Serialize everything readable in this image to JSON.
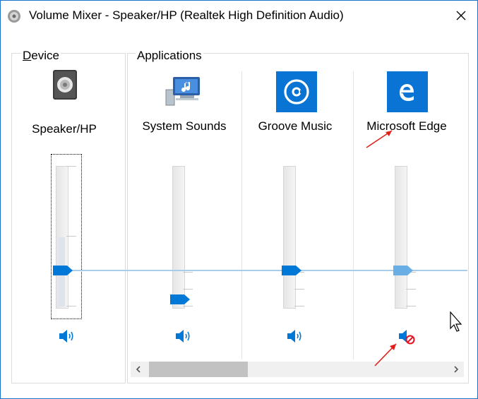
{
  "window": {
    "title": "Volume Mixer - Speaker/HP (Realtek High Definition Audio)",
    "accent": "#0078d7"
  },
  "device": {
    "group_label_prefix": "",
    "group_label_mnemonic": "D",
    "group_label_rest": "evice",
    "name": "Speaker/HP",
    "icon": "speaker-box-icon",
    "volume_percent": 50,
    "muted": false
  },
  "applications": {
    "group_label": "Applications",
    "items": [
      {
        "name": "System Sounds",
        "icon": "system-sounds-icon",
        "volume_percent": 5,
        "muted": false
      },
      {
        "name": "Groove Music",
        "icon": "groove-music-icon",
        "volume_percent": 50,
        "muted": false
      },
      {
        "name": "Microsoft Edge",
        "icon": "microsoft-edge-icon",
        "volume_percent": 50,
        "muted": true
      }
    ]
  },
  "scrollbar": {
    "position_fraction": 0.0,
    "visible_fraction": 0.33
  },
  "colors": {
    "thumb": "#0078d7",
    "thumb_inactive": "#6aaee6",
    "mute_badge": "#e81123"
  }
}
